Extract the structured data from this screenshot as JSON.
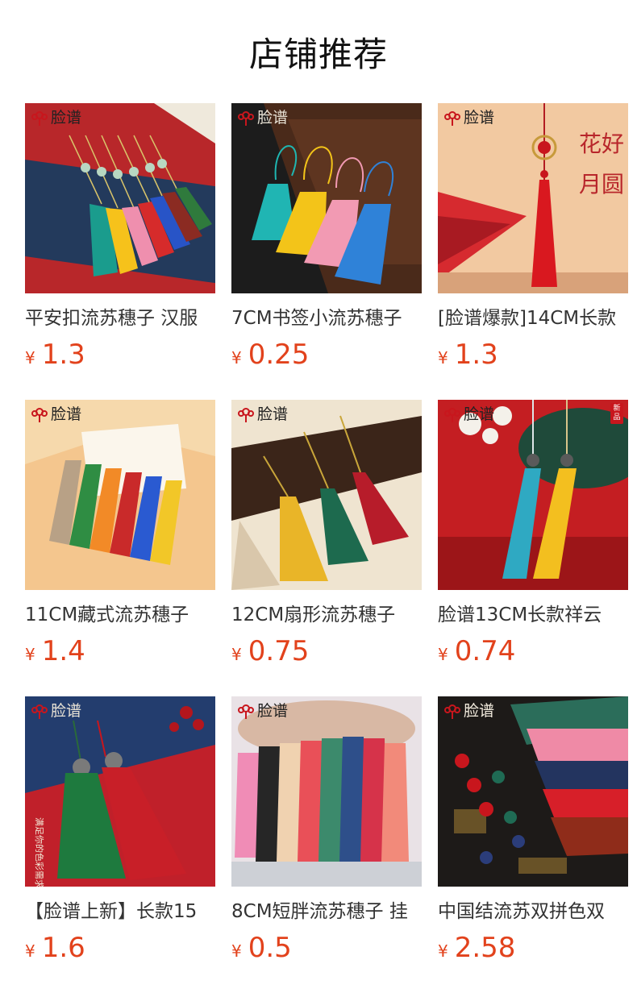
{
  "page_title": "店铺推荐",
  "brand_name": "脸谱",
  "new_badge_text": "新品",
  "currency_symbol": "¥",
  "colors": {
    "price": "#e2421c",
    "brand_red": "#c8161d"
  },
  "products": [
    {
      "name": "平安扣流苏穗子 汉服",
      "price": "1.3",
      "image": "colorful-tassels-with-jade-discs-on-red",
      "has_logo": true
    },
    {
      "name": "7CM书签小流苏穗子",
      "price": "0.25",
      "image": "small-tassels-on-dark-wooden-tray",
      "has_logo": true
    },
    {
      "name": "[脸谱爆款]14CM长款",
      "price": "1.3",
      "image": "red-tassel-with-fan-and-calligraphy",
      "has_logo": true
    },
    {
      "name": "11CM藏式流苏穗子",
      "price": "1.4",
      "image": "rainbow-tassels-on-cream-background",
      "has_logo": true
    },
    {
      "name": "12CM扇形流苏穗子",
      "price": "0.75",
      "image": "fan-tassels-on-dark-wood",
      "has_logo": true
    },
    {
      "name": "脸谱13CM长款祥云",
      "price": "0.74",
      "image": "long-blue-and-yellow-tassels-on-red",
      "has_logo": true,
      "has_new_badge": true
    },
    {
      "name": "【脸谱上新】长款15",
      "price": "1.6",
      "image": "green-and-red-tassels-on-blue-red",
      "has_logo": true,
      "overlay_text": "满足你的色彩需求 多种颜色"
    },
    {
      "name": "8CM短胖流苏穗子 挂",
      "price": "0.5",
      "image": "chubby-tassels-in-hand",
      "has_logo": true
    },
    {
      "name": "中国结流苏双拼色双",
      "price": "2.58",
      "image": "chinese-knot-two-tone-tassels-on-calligraphy",
      "has_logo": true
    }
  ]
}
